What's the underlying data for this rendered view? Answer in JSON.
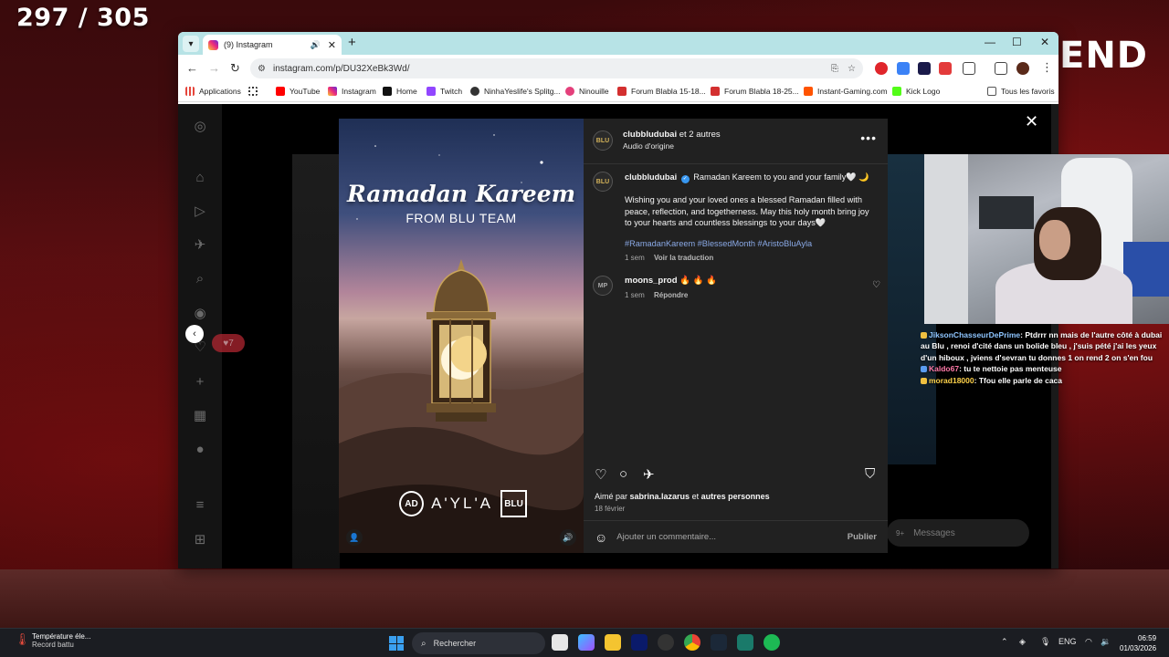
{
  "stream": {
    "counter": "297 / 305",
    "end_text": "END"
  },
  "browser": {
    "tab_title": "(9) Instagram",
    "url": "instagram.com/p/DU32XeBk3Wd/",
    "bookmarks": [
      {
        "label": "Applications",
        "color": "#e5453b"
      },
      {
        "label": "YouTube",
        "color": "#ff0000"
      },
      {
        "label": "Instagram",
        "color": "#d62976"
      },
      {
        "label": "Home",
        "color": "#111111"
      },
      {
        "label": "Twitch",
        "color": "#9146ff"
      },
      {
        "label": "NinhaYeslife's Splitg...",
        "color": "#333333"
      },
      {
        "label": "Ninouille",
        "color": "#e4407b"
      },
      {
        "label": "Forum Blabla 15-18...",
        "color": "#d32f2f"
      },
      {
        "label": "Forum Blabla 18-25...",
        "color": "#d32f2f"
      },
      {
        "label": "Instant-Gaming.com",
        "color": "#ff5400"
      },
      {
        "label": "Kick Logo",
        "color": "#53fc18"
      }
    ],
    "all_bookmarks": "Tous les favoris"
  },
  "instagram": {
    "notif_count": "7",
    "messages_label": "Messages",
    "messages_count": "9+",
    "post": {
      "header_user": "clubbludubai",
      "header_others": "et 2 autres",
      "audio": "Audio d'origine",
      "reel_title": "Ramadan Kareem",
      "reel_subtitle": "FROM BLU TEAM",
      "reel_logo_ayla": "A'YL'A",
      "reel_logo_blu": "BLU",
      "reel_logo_ad": "AD",
      "caption_user": "clubbludubai",
      "caption_line1": "Ramadan Kareem to you and your family🤍 🌙",
      "caption_body": "Wishing you and your loved ones a blessed Ramadan filled with peace, reflection, and togetherness. May this holy month bring joy to your hearts and countless blessings to your days🤍",
      "hashtags": "#RamadanKareem #BlessedMonth #AristoBluAyla",
      "caption_time": "1 sem",
      "translate": "Voir la traduction",
      "comment_user": "moons_prod",
      "comment_text": "🔥 🔥 🔥",
      "comment_time": "1 sem",
      "reply": "Répondre",
      "liked_by_prefix": "Aimé par",
      "liked_by_user": "sabrina.lazarus",
      "liked_by_mid": "et",
      "liked_by_suffix": "autres personnes",
      "date": "18 février",
      "comment_placeholder": "Ajouter un commentaire...",
      "publish": "Publier"
    }
  },
  "chat": [
    {
      "user": "JiksonChasseurDePrime",
      "color": "#8ec5ff",
      "text": "Ptdrrr nn mais de l'autre côté à dubai au Blu , renoi d'cité dans un bolide bleu , j'suis pété j'ai les yeux d'un hiboux , jviens d'sevran tu donnes 1 on rend 2 on s'en fou"
    },
    {
      "user": "Kaldo67",
      "color": "#ff7aa8",
      "text": "tu te nettoie pas menteuse"
    },
    {
      "user": "morad18000",
      "color": "#ffd24a",
      "text": "Tfou elle parle de caca"
    }
  ],
  "taskbar": {
    "weather_title": "Température éle...",
    "weather_sub": "Record battu",
    "weather_badge": "2",
    "search_label": "Rechercher",
    "lang": "ENG",
    "time": "06:59",
    "date": "01/03/2026"
  }
}
